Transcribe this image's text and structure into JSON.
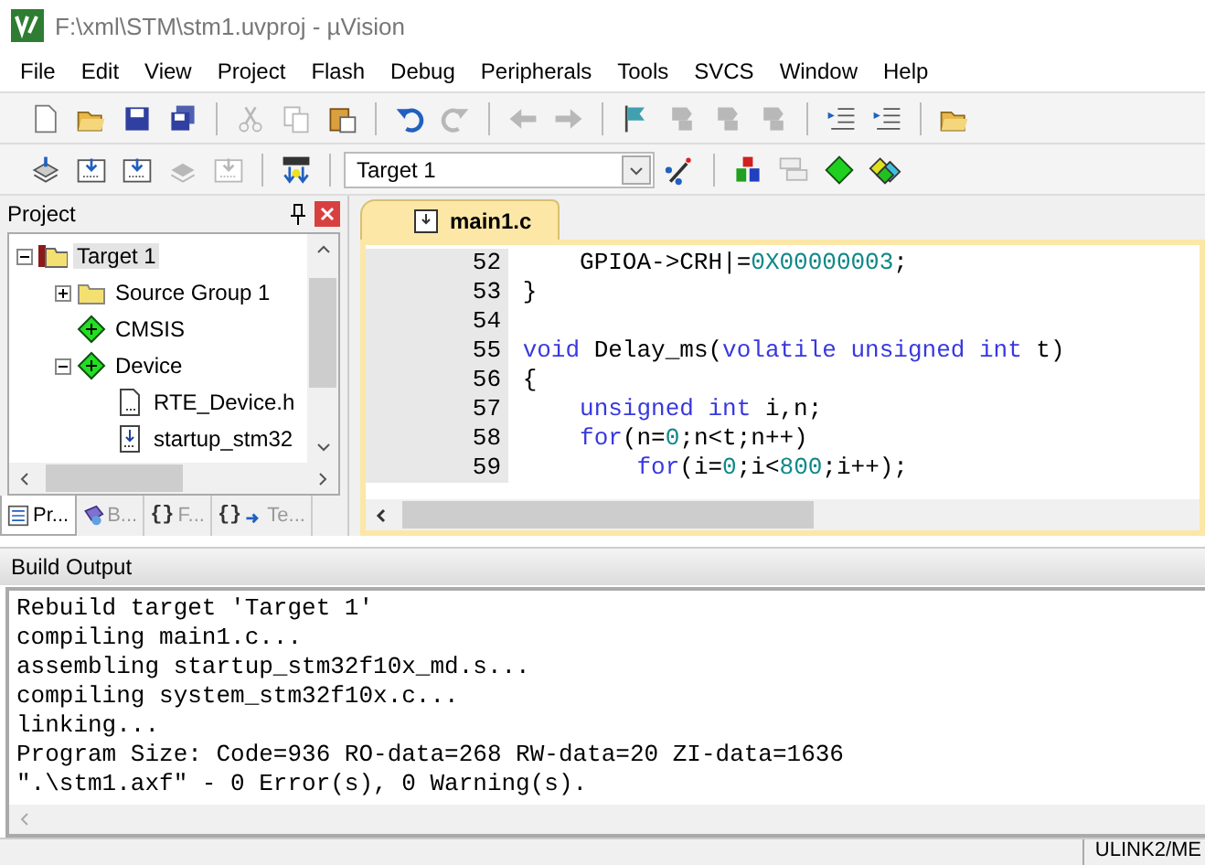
{
  "window": {
    "title": "F:\\xml\\STM\\stm1.uvproj - µVision"
  },
  "menu": [
    "File",
    "Edit",
    "View",
    "Project",
    "Flash",
    "Debug",
    "Peripherals",
    "Tools",
    "SVCS",
    "Window",
    "Help"
  ],
  "toolbar": [
    {
      "disabled": false
    },
    {
      "disabled": false
    },
    {
      "disabled": false
    },
    {
      "disabled": false
    },
    {
      "disabled": true
    },
    {
      "disabled": true
    },
    {
      "disabled": false
    },
    {
      "disabled": false
    },
    {
      "disabled": true
    },
    {
      "disabled": true
    },
    {
      "disabled": true
    },
    {
      "disabled": false
    },
    {
      "disabled": true
    },
    {
      "disabled": true
    },
    {
      "disabled": true
    },
    {
      "disabled": false
    },
    {
      "disabled": false
    },
    {
      "disabled": false
    }
  ],
  "build_toolbar": {
    "buttons": [
      {
        "disabled": false
      },
      {
        "disabled": false
      },
      {
        "disabled": false
      },
      {
        "disabled": true
      },
      {
        "disabled": true
      },
      {
        "disabled": false
      }
    ],
    "target": "Target 1",
    "buttons_after": [
      {
        "disabled": false
      },
      {
        "disabled": false
      },
      {
        "disabled": true
      },
      {
        "disabled": false
      },
      {
        "disabled": false
      }
    ]
  },
  "project": {
    "title": "Project",
    "tree": [
      {
        "label": "Target 1",
        "kind": "target",
        "selected": true,
        "expanded": true,
        "children": [
          {
            "label": "Source Group 1",
            "kind": "folder",
            "selected": false,
            "expanded": false
          },
          {
            "label": "CMSIS",
            "kind": "component",
            "selected": false
          },
          {
            "label": "Device",
            "kind": "component",
            "selected": false,
            "expanded": true,
            "children": [
              {
                "label": "RTE_Device.h",
                "kind": "file",
                "selected": false
              },
              {
                "label": "startup_stm32",
                "kind": "asm",
                "selected": false
              }
            ]
          }
        ]
      }
    ],
    "tabs": [
      {
        "label": "Pr...",
        "kind": "project",
        "selected": true
      },
      {
        "label": "B...",
        "kind": "books",
        "selected": false
      },
      {
        "label": "F...",
        "kind": "functions",
        "glyph": "{}",
        "selected": false
      },
      {
        "label": "Te...",
        "kind": "templates",
        "glyph": "{}",
        "selected": false
      }
    ]
  },
  "editor": {
    "tabs": [
      {
        "label": "main1.c",
        "selected": true
      }
    ],
    "lines": [
      {
        "number": "52",
        "tokens": [
          {
            "text": "    GPIOA->CRH|=",
            "kind": "plain"
          },
          {
            "text": "0X00000003",
            "kind": "number"
          },
          {
            "text": ";",
            "kind": "plain"
          }
        ]
      },
      {
        "number": "53",
        "tokens": [
          {
            "text": "}",
            "kind": "plain"
          }
        ]
      },
      {
        "number": "54"
      },
      {
        "number": "55",
        "tokens": [
          {
            "text": "void",
            "kind": "keyword"
          },
          {
            "text": " Delay_ms(",
            "kind": "plain"
          },
          {
            "text": "volatile unsigned int",
            "kind": "keyword"
          },
          {
            "text": " t)",
            "kind": "plain"
          }
        ]
      },
      {
        "number": "56",
        "tokens": [
          {
            "text": "{",
            "kind": "plain"
          }
        ]
      },
      {
        "number": "57",
        "tokens": [
          {
            "text": "    unsigned int",
            "kind": "keyword"
          },
          {
            "text": " i,n;",
            "kind": "plain"
          }
        ]
      },
      {
        "number": "58",
        "tokens": [
          {
            "text": "    for",
            "kind": "keyword"
          },
          {
            "text": "(n=",
            "kind": "plain"
          },
          {
            "text": "0",
            "kind": "number"
          },
          {
            "text": ";n<t;n++)",
            "kind": "plain"
          }
        ]
      },
      {
        "number": "59",
        "tokens": [
          {
            "text": "        for",
            "kind": "keyword"
          },
          {
            "text": "(i=",
            "kind": "plain"
          },
          {
            "text": "0",
            "kind": "number"
          },
          {
            "text": ";i<",
            "kind": "plain"
          },
          {
            "text": "800",
            "kind": "number"
          },
          {
            "text": ";i++);",
            "kind": "plain"
          }
        ]
      }
    ]
  },
  "build_output": {
    "title": "Build Output",
    "lines": [
      "Rebuild target 'Target 1'",
      "compiling main1.c...",
      "assembling startup_stm32f10x_md.s...",
      "compiling system_stm32f10x.c...",
      "linking...",
      "Program Size: Code=936 RO-data=268 RW-data=20 ZI-data=1636",
      "\".\\stm1.axf\" - 0 Error(s), 0 Warning(s)."
    ]
  },
  "status_bar": {
    "debugger": "ULINK2/ME"
  }
}
